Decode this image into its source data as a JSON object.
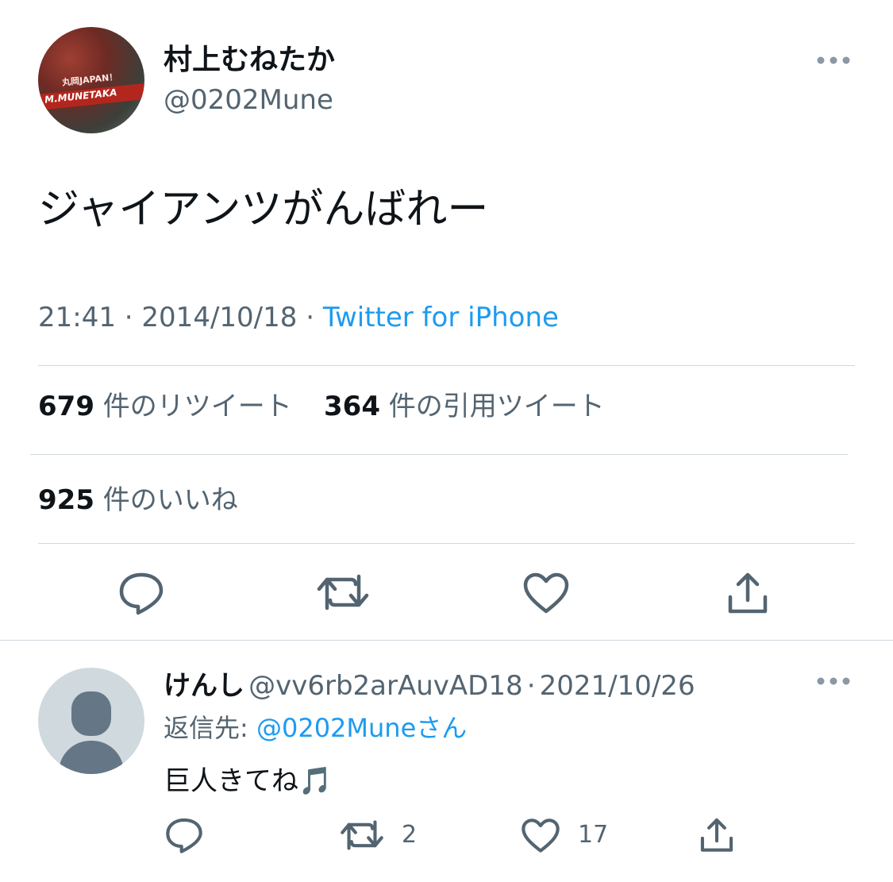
{
  "tweet": {
    "author_name": "村上むねたか",
    "author_handle": "@0202Mune",
    "text": "ジャイアンツがんばれー",
    "time": "21:41",
    "date": "2014/10/18",
    "source": "Twitter for iPhone",
    "more_icon": "more-horizontal-icon",
    "avatar_text_top": "丸岡JAPAN！",
    "avatar_text_band": "M.MUNETAKA"
  },
  "stats": {
    "retweets_count": "679",
    "retweets_label": "件のリツイート",
    "quotes_count": "364",
    "quotes_label": "件の引用ツイート",
    "likes_count": "925",
    "likes_label": "件のいいね"
  },
  "actions": {
    "reply_icon": "reply-icon",
    "retweet_icon": "retweet-icon",
    "like_icon": "heart-icon",
    "share_icon": "share-icon"
  },
  "reply": {
    "author_name": "けんし",
    "author_handle": "@vv6rb2arAuvAD18",
    "separator": "·",
    "date": "2021/10/26",
    "reply_to_label": "返信先:",
    "reply_to_handle": "@0202Mune",
    "reply_to_suffix": "さん",
    "text": "巨人きてね🎵",
    "retweets": "2",
    "likes": "17"
  },
  "colors": {
    "text": "#0f1419",
    "secondary": "#536471",
    "link": "#1d9bf0",
    "divider": "#cfd9de"
  }
}
